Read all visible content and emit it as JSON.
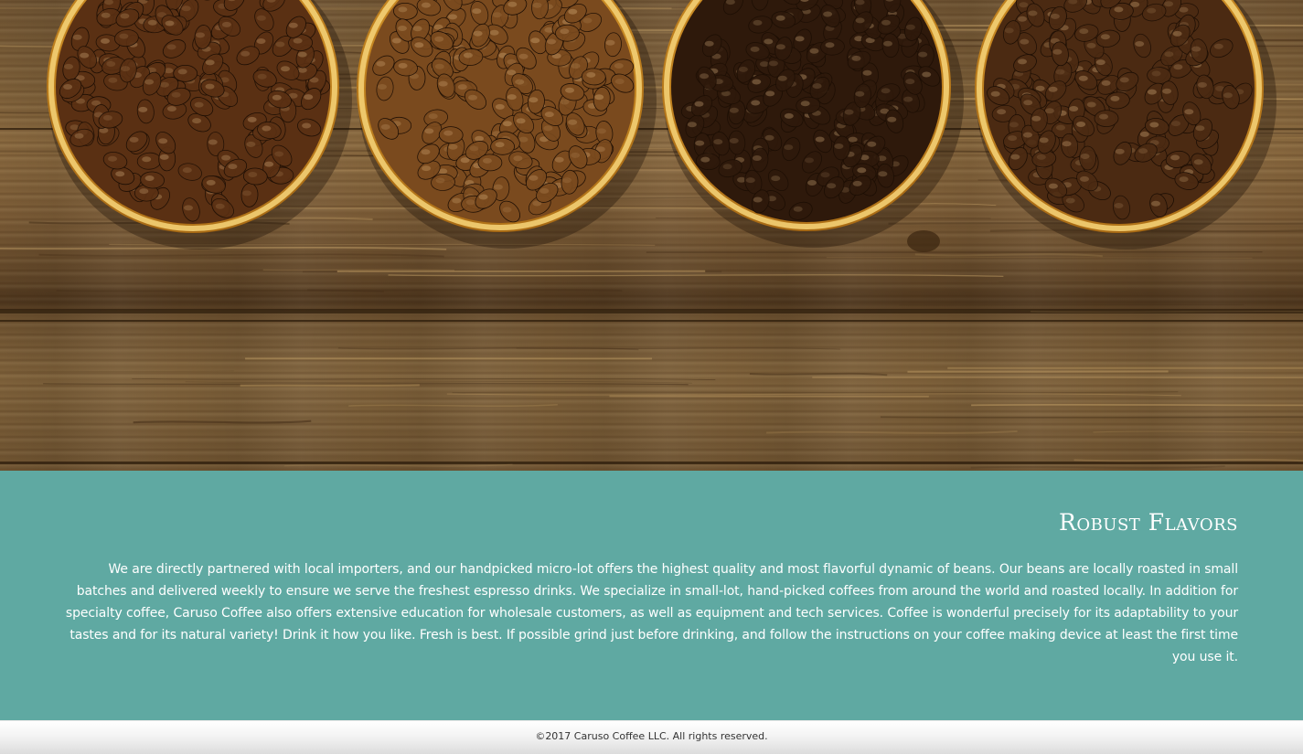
{
  "hero": {
    "image": "coffee-beans-bowls-on-wood-photo",
    "bowls": [
      "medium-roast",
      "light-roast",
      "dark-roast",
      "medium-dark-roast"
    ]
  },
  "about": {
    "heading": "Robust Flavors",
    "body": "We are directly partnered with local importers, and our handpicked micro-lot offers the highest quality and most flavorful dynamic of beans. Our beans are locally roasted in small batches and delivered weekly to ensure we serve the freshest espresso drinks. We specialize in small-lot, hand-picked coffees from around the world and roasted locally. In addition for specialty coffee, Caruso Coffee also offers extensive education for wholesale customers, as well as equipment and tech services. Coffee is wonderful precisely for its adaptability to your tastes and for its natural variety! Drink it how you like. Fresh is best. If possible grind just before drinking, and follow the instructions on your coffee making device at least the first time you use it."
  },
  "footer": {
    "copyright": "©2017 Caruso Coffee LLC. All rights reserved."
  },
  "colors": {
    "about_background": "#5fa9a2",
    "about_text": "#ffffff",
    "footer_text": "#333333"
  }
}
